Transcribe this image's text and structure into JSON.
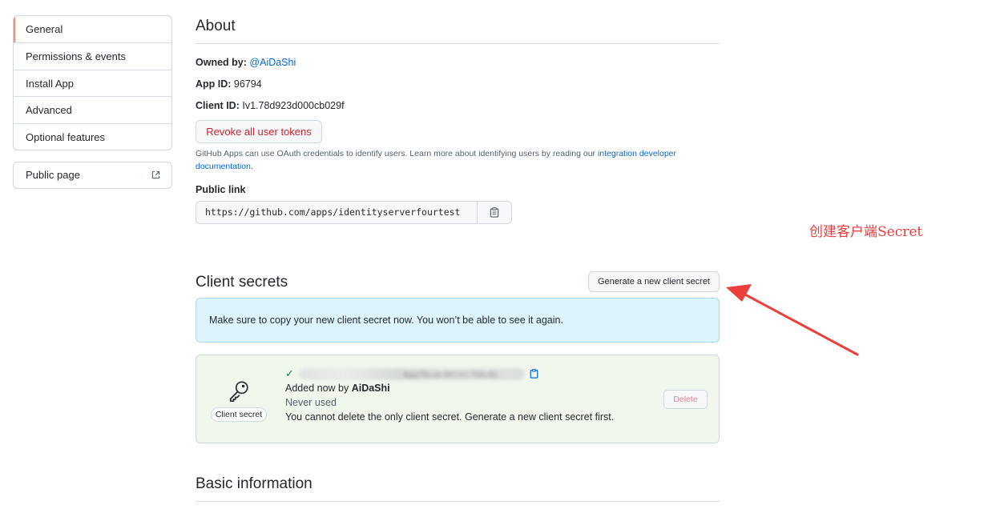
{
  "sidebar": {
    "items": [
      {
        "label": "General"
      },
      {
        "label": "Permissions & events"
      },
      {
        "label": "Install App"
      },
      {
        "label": "Advanced"
      },
      {
        "label": "Optional features"
      }
    ],
    "public_page": {
      "label": "Public page",
      "icon": "external-link-icon"
    }
  },
  "about": {
    "title": "About",
    "owned_by_label": "Owned by:",
    "owned_by_value": "@AiDaShi",
    "app_id_label": "App ID:",
    "app_id_value": "96794",
    "client_id_label": "Client ID:",
    "client_id_value": "Iv1.78d923d000cb029f",
    "revoke_button": "Revoke all user tokens",
    "note_text": "GitHub Apps can use OAuth credentials to identify users. Learn more about identifying users by reading our ",
    "note_link": "integration developer documentation",
    "note_end": ".",
    "public_link_label": "Public link",
    "public_link_value": "https://github.com/apps/identityserverfourtest"
  },
  "client_secrets": {
    "title": "Client secrets",
    "generate_button": "Generate a new client secret",
    "flash_message": "Make sure to copy your new client secret now. You won’t be able to see it again.",
    "secret": {
      "icon_label": "Client secret",
      "partial_value": "4aa70cdc90191766c8c",
      "added_prefix": "Added now by ",
      "added_by": "AiDaShi",
      "usage": "Never used",
      "warning": "You cannot delete the only client secret. Generate a new client secret first.",
      "delete_button": "Delete"
    }
  },
  "basic_info": {
    "title": "Basic information"
  },
  "annotation": {
    "text": "创建客户端Secret",
    "color": "#ea3f3a"
  },
  "colors": {
    "accent": "#0969da",
    "danger": "#cf222e",
    "active_indicator": "#fd8c73",
    "success": "#1a7f37"
  }
}
